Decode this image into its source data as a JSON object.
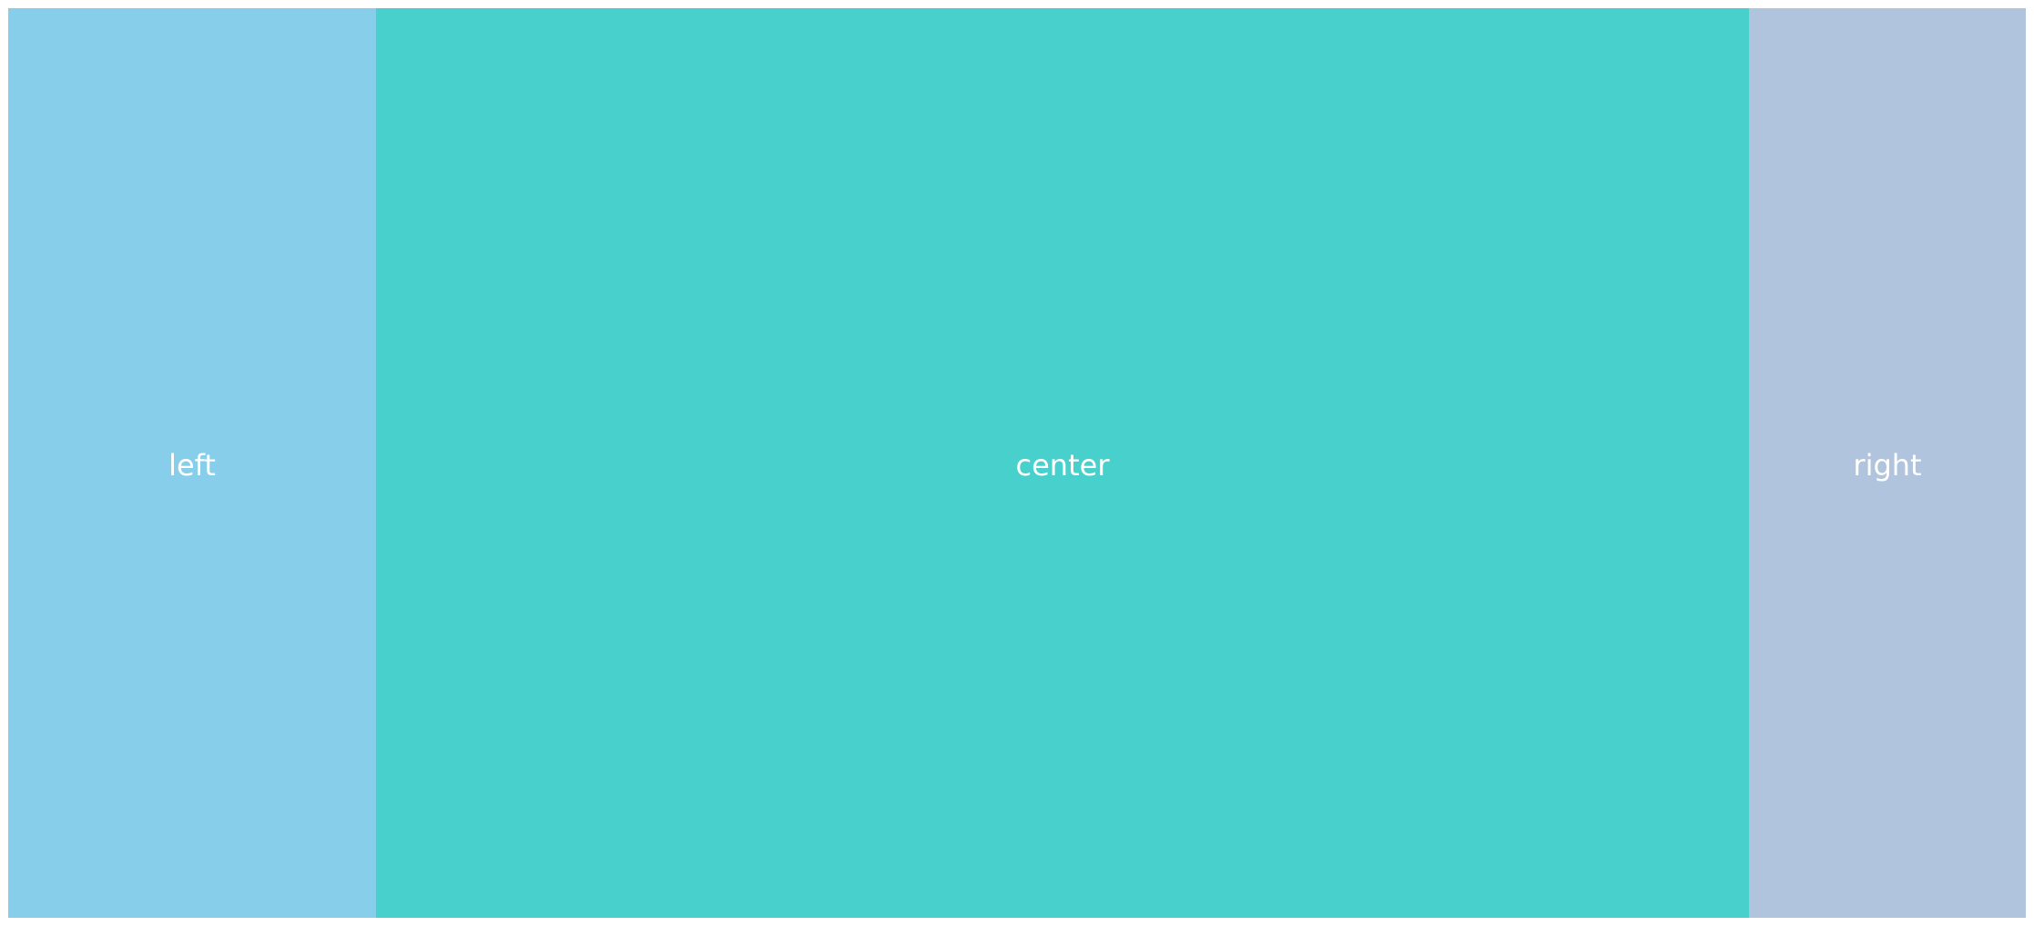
{
  "panels": {
    "left": {
      "label": "left",
      "color": "#87CEEB"
    },
    "center": {
      "label": "center",
      "color": "#48D1CC"
    },
    "right": {
      "label": "right",
      "color": "#B0C4DE"
    }
  }
}
